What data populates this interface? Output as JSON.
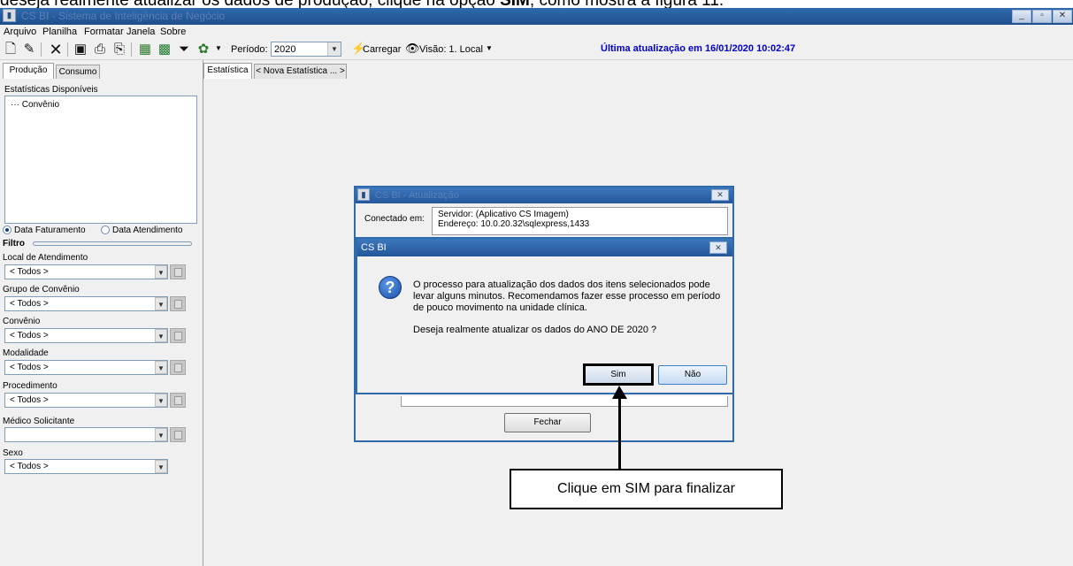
{
  "doc_caption": {
    "before": "deseja realmente atualizar os dados de produção, clique na opção ",
    "bold": "SIM",
    "after": ", como mostra a figura 11."
  },
  "window": {
    "title": "CS BI - Sistema de Inteligência de Negócio",
    "controls": [
      "_",
      "▫",
      "✕"
    ]
  },
  "menu": [
    "Arquivo",
    "Planilha",
    "Formatar",
    "Janela",
    "Sobre"
  ],
  "toolbar": {
    "period_label": "Período:",
    "period_value": "2020",
    "load_label": "Carregar",
    "view_label": "Visão: 1. Local",
    "last_update": "Última atualização em 16/01/2020 10:02:47"
  },
  "left_panel": {
    "tabs": [
      "Produção",
      "Consumo"
    ],
    "stats_label": "Estatísticas Disponíveis",
    "tree_items": [
      "Convênio"
    ],
    "radio_options": [
      "Data Faturamento",
      "Data Atendimento"
    ],
    "filter_label": "Filtro",
    "filters": [
      {
        "label": "Local de Atendimento",
        "value": "< Todos >"
      },
      {
        "label": "Grupo de Convênio",
        "value": "< Todos >"
      },
      {
        "label": "Convênio",
        "value": "< Todos >"
      },
      {
        "label": "Modalidade",
        "value": "< Todos >"
      },
      {
        "label": "Procedimento",
        "value": "< Todos >"
      },
      {
        "label": "Médico Solicitante",
        "value": ""
      },
      {
        "label": "Sexo",
        "value": "< Todos >"
      }
    ]
  },
  "main_tabs": [
    "Estatística",
    "< Nova Estatística ... >"
  ],
  "overlay_window": {
    "title": "CS BI - Atualização",
    "connected_label": "Conectado em:",
    "lines": [
      "Servidor: (Aplicativo CS Imagem)",
      "Endereço: 10.0.20.32\\sqlexpress,1433"
    ],
    "close_label": "Fechar"
  },
  "dialog": {
    "title": "CS BI",
    "message_lines": [
      "O processo para atualização dos dados dos itens selecionados pode",
      "levar alguns minutos. Recomendamos fazer esse processo em período",
      "de pouco movimento na unidade clínica."
    ],
    "question": "Deseja realmente atualizar os dados do ANO DE 2020 ?",
    "yes_label": "Sim",
    "no_label": "Não"
  },
  "callout_text": "Clique em SIM para finalizar"
}
